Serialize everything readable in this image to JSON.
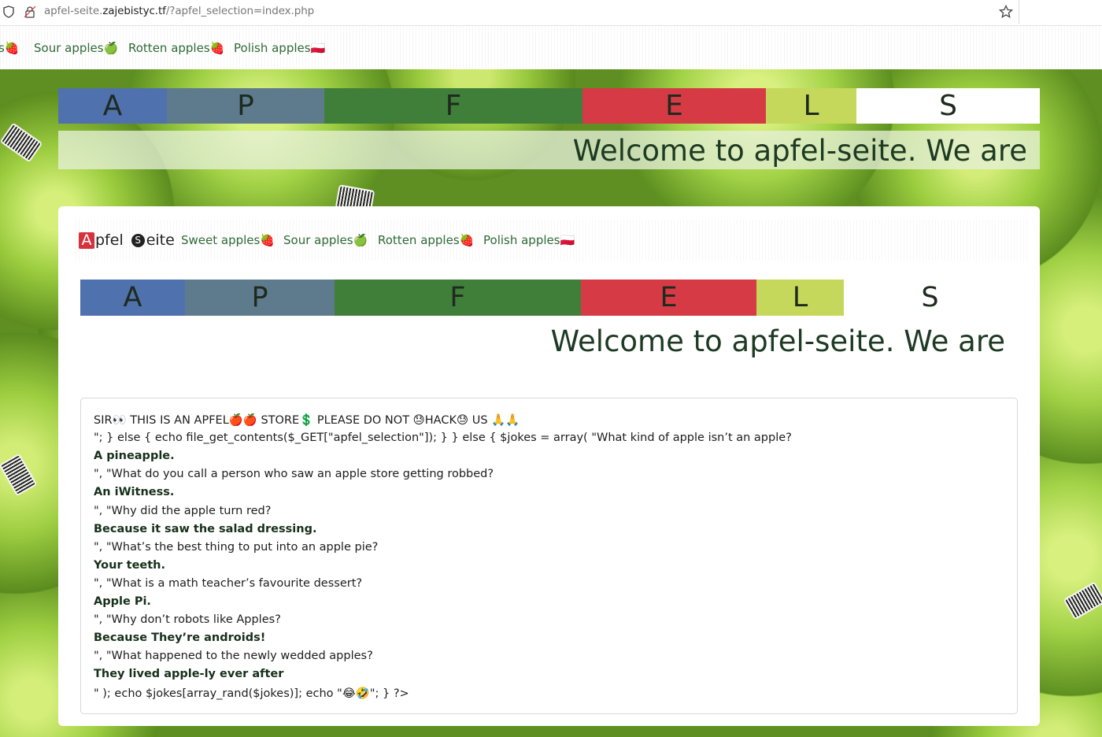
{
  "browser": {
    "url_prefix": "apfel-seite.",
    "url_domain": "zajebistyc.tf",
    "url_path": "/?apfel_selection=index.php"
  },
  "outer_nav": {
    "items": [
      "s🍓",
      "Sour apples🍏",
      "Rotten apples🍓",
      "Polish apples🇵🇱"
    ]
  },
  "title_letters": [
    "A",
    "P",
    "F",
    "E",
    "L",
    "S"
  ],
  "welcome_text": "Welcome to apfel-seite. We are",
  "inner_nav": {
    "brand_first_letter": "A",
    "brand_first_rest": "pfel",
    "brand_second_letter": "S",
    "brand_second_rest": "eite",
    "items": [
      "Sweet apples🍓",
      "Sour apples🍏",
      "Rotten apples🍓",
      "Polish apples🇵🇱"
    ]
  },
  "content": {
    "lines": [
      {
        "text": "SIR👀 THIS IS AN APFEL🍎🍎 STORE💲 PLEASE DO NOT 😓HACK😓 US 🙏🙏",
        "bold": false
      },
      {
        "text": "\"; } else { echo file_get_contents($_GET[\"apfel_selection\"]); } } else { $jokes = array( \"What kind of apple isn’t an apple?",
        "bold": false
      },
      {
        "text": "A pineapple.",
        "bold": true
      },
      {
        "text": "\", \"What do you call a person who saw an apple store getting robbed?",
        "bold": false
      },
      {
        "text": "An iWitness.",
        "bold": true
      },
      {
        "text": "\", \"Why did the apple turn red?",
        "bold": false
      },
      {
        "text": "Because it saw the salad dressing.",
        "bold": true
      },
      {
        "text": "\", \"What’s the best thing to put into an apple pie?",
        "bold": false
      },
      {
        "text": "Your teeth.",
        "bold": true
      },
      {
        "text": "\", \"What is a math teacher’s favourite dessert?",
        "bold": false
      },
      {
        "text": "Apple Pi.",
        "bold": true
      },
      {
        "text": "\", \"Why don’t robots like Apples?",
        "bold": false
      },
      {
        "text": "Because They’re androids!",
        "bold": true
      },
      {
        "text": "\", \"What happened to the newly wedded apples?",
        "bold": false
      },
      {
        "text": "They lived apple-ly ever after",
        "bold": true
      },
      {
        "text": "\" ); echo $jokes[array_rand($jokes)]; echo \"😂🤣\"; } ?>",
        "bold": false
      }
    ]
  },
  "colors": {
    "A": "#4f72ae",
    "P": "#5e7b8e",
    "F": "#3f7f3a",
    "E": "#d63a45",
    "L": "#c5d85c",
    "S": "#ffffff",
    "nav_link": "#2e6a35"
  }
}
